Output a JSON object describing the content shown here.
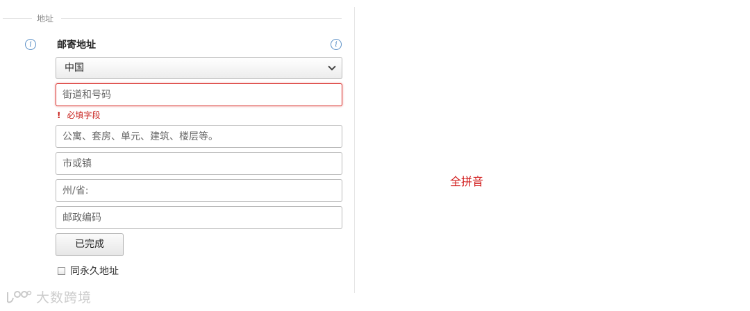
{
  "section": {
    "legend": "地址"
  },
  "address": {
    "title": "邮寄地址",
    "country_select": {
      "selected": "中国"
    },
    "street": {
      "placeholder": "街道和号码",
      "error": "必填字段",
      "error_mark": "!"
    },
    "apartment": {
      "placeholder": "公寓、套房、单元、建筑、楼层等。"
    },
    "city": {
      "placeholder": "市或镇"
    },
    "state": {
      "placeholder": "州/省:"
    },
    "postal": {
      "placeholder": "邮政编码"
    },
    "done_button": "已完成",
    "permanent_checkbox": {
      "label": "同永久地址",
      "checked": false
    }
  },
  "icons": {
    "info": "i",
    "info_color": "#5a8fc6"
  },
  "annotation": {
    "text": "全拼音",
    "color": "#d21f1f"
  },
  "watermark": {
    "text": "大数跨境"
  }
}
